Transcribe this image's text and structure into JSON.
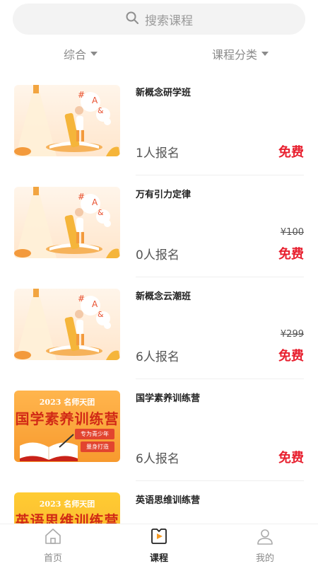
{
  "search": {
    "placeholder": "搜索课程"
  },
  "filters": [
    {
      "label": "综合"
    },
    {
      "label": "课程分类"
    }
  ],
  "courses": [
    {
      "title": "新概念研学班",
      "enrolled": "1人报名",
      "price": "免费",
      "original_price": "",
      "thumb": "illustration"
    },
    {
      "title": "万有引力定律",
      "enrolled": "0人报名",
      "price": "免费",
      "original_price": "¥100",
      "thumb": "illustration"
    },
    {
      "title": "新概念云潮班",
      "enrolled": "6人报名",
      "price": "免费",
      "original_price": "¥299",
      "thumb": "illustration"
    },
    {
      "title": "国学素养训练营",
      "enrolled": "6人报名",
      "price": "免费",
      "original_price": "",
      "thumb": "promo",
      "promo": {
        "sub": "2023 名师天团",
        "main": "国学素养训练营",
        "tag1": "专为青少年",
        "tag2": "量身打造"
      }
    },
    {
      "title": "英语思维训练营",
      "enrolled": "",
      "price": "",
      "original_price": "",
      "thumb": "promo",
      "promo": {
        "sub": "2023 名师天团",
        "main": "英语思维训练营",
        "tag1": "",
        "tag2": ""
      }
    }
  ],
  "tabbar": [
    {
      "label": "首页",
      "icon": "home-icon",
      "active": false
    },
    {
      "label": "课程",
      "icon": "course-icon",
      "active": true
    },
    {
      "label": "我的",
      "icon": "profile-icon",
      "active": false
    }
  ],
  "colors": {
    "accent": "#e8202f",
    "promo_bg": "#f79a2e",
    "promo_title": "#d12a16"
  }
}
